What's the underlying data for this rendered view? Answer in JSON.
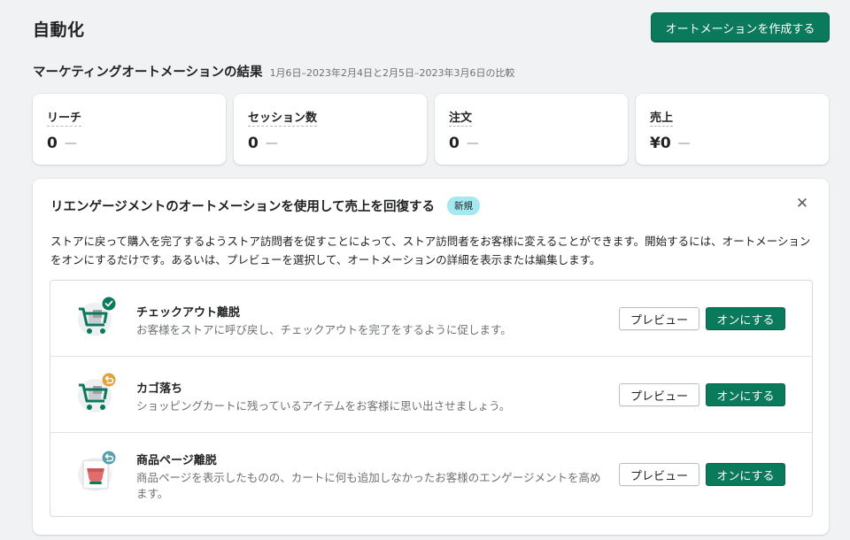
{
  "header": {
    "title": "自動化",
    "create_button": "オートメーションを作成する"
  },
  "results": {
    "title": "マーケティングオートメーションの結果",
    "date_range": "1月6日–2023年2月4日と2月5日–2023年3月6日の比較"
  },
  "metrics": [
    {
      "label": "リーチ",
      "value": "0",
      "change": "—"
    },
    {
      "label": "セッション数",
      "value": "0",
      "change": "—"
    },
    {
      "label": "注文",
      "value": "0",
      "change": "—"
    },
    {
      "label": "売上",
      "value": "¥0",
      "change": "—"
    }
  ],
  "reengagement": {
    "title": "リエンゲージメントのオートメーションを使用して売上を回復する",
    "badge": "新規",
    "close_symbol": "✕",
    "description": "ストアに戻って購入を完了するようストア訪問者を促すことによって、ストア訪問者をお客様に変えることができます。開始するには、オートメーションをオンにするだけです。あるいは、プレビューを選択して、オートメーションの詳細を表示または編集します。",
    "items": [
      {
        "title": "チェックアウト離脱",
        "description": "お客様をストアに呼び戻し、チェックアウトを完了をするように促します。",
        "icon": "cart-check-icon",
        "preview_label": "プレビュー",
        "enable_label": "オンにする"
      },
      {
        "title": "カゴ落ち",
        "description": "ショッピングカートに残っているアイテムをお客様に思い出させましょう。",
        "icon": "cart-return-icon",
        "preview_label": "プレビュー",
        "enable_label": "オンにする"
      },
      {
        "title": "商品ページ離脱",
        "description": "商品ページを表示したものの、カートに何も追加しなかったお客様のエンゲージメントを高めます。",
        "icon": "product-page-return-icon",
        "preview_label": "プレビュー",
        "enable_label": "オンにする"
      }
    ]
  },
  "colors": {
    "primary": "#0b7a5c",
    "badge": "#a4e8f2",
    "background": "#f1f2f4",
    "check_badge": "#0b7a5c",
    "return_badge_orange": "#e0a33c",
    "return_badge_teal": "#5a9fb0"
  }
}
